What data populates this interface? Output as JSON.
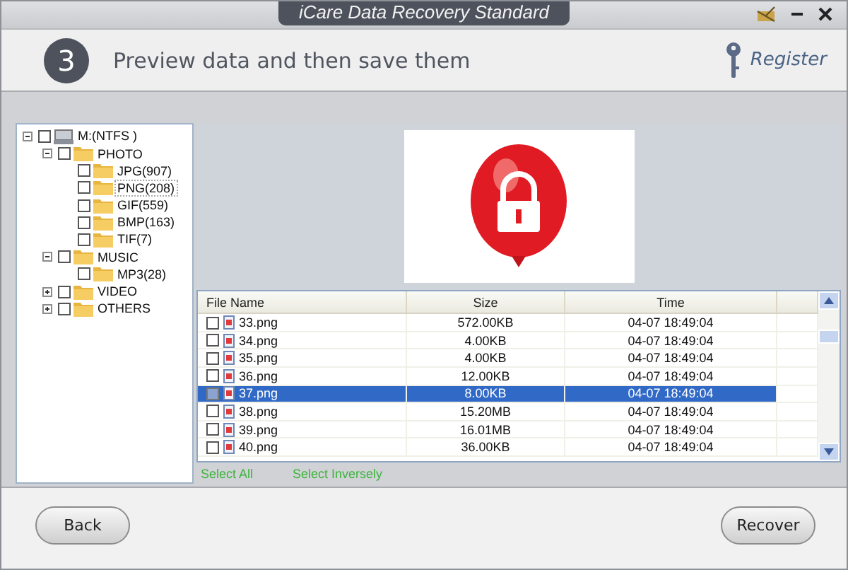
{
  "window": {
    "title": "iCare Data Recovery Standard"
  },
  "header": {
    "step": "3",
    "heading": "Preview data and then save them",
    "register": "Register"
  },
  "tree": [
    {
      "label": "M:(NTFS )",
      "kind": "drive",
      "checked": false,
      "expanded": true,
      "children": [
        {
          "label": "PHOTO",
          "kind": "folder",
          "checked": false,
          "expanded": true,
          "children": [
            {
              "label": "JPG(907)",
              "kind": "folder",
              "checked": false
            },
            {
              "label": "PNG(208)",
              "kind": "folder",
              "checked": false,
              "selected": true
            },
            {
              "label": "GIF(559)",
              "kind": "folder",
              "checked": false
            },
            {
              "label": "BMP(163)",
              "kind": "folder",
              "checked": false
            },
            {
              "label": "TIF(7)",
              "kind": "folder",
              "checked": false
            }
          ]
        },
        {
          "label": "MUSIC",
          "kind": "folder",
          "checked": false,
          "expanded": true,
          "children": [
            {
              "label": "MP3(28)",
              "kind": "folder",
              "checked": false
            }
          ]
        },
        {
          "label": "VIDEO",
          "kind": "folder",
          "checked": false,
          "expanded": false
        },
        {
          "label": "OTHERS",
          "kind": "folder",
          "checked": false,
          "expanded": false
        }
      ]
    }
  ],
  "preview": {
    "kind": "picture"
  },
  "table": {
    "columns": [
      "File Name",
      "Size",
      "Time"
    ],
    "rows": [
      {
        "name": "33.png",
        "size": "572.00KB",
        "time": "04-07 18:49:04",
        "checked": false,
        "selected": false
      },
      {
        "name": "34.png",
        "size": "4.00KB",
        "time": "04-07 18:49:04",
        "checked": false,
        "selected": false
      },
      {
        "name": "35.png",
        "size": "4.00KB",
        "time": "04-07 18:49:04",
        "checked": false,
        "selected": false
      },
      {
        "name": "36.png",
        "size": "12.00KB",
        "time": "04-07 18:49:04",
        "checked": false,
        "selected": false
      },
      {
        "name": "37.png",
        "size": "8.00KB",
        "time": "04-07 18:49:04",
        "checked": false,
        "selected": true
      },
      {
        "name": "38.png",
        "size": "15.20MB",
        "time": "04-07 18:49:04",
        "checked": false,
        "selected": false
      },
      {
        "name": "39.png",
        "size": "16.01MB",
        "time": "04-07 18:49:04",
        "checked": false,
        "selected": false
      },
      {
        "name": "40.png",
        "size": "36.00KB",
        "time": "04-07 18:49:04",
        "checked": false,
        "selected": false
      }
    ]
  },
  "links": [
    "Select All",
    "Select Inversely"
  ],
  "buttons": {
    "back": "Back",
    "recover": "Recover"
  }
}
